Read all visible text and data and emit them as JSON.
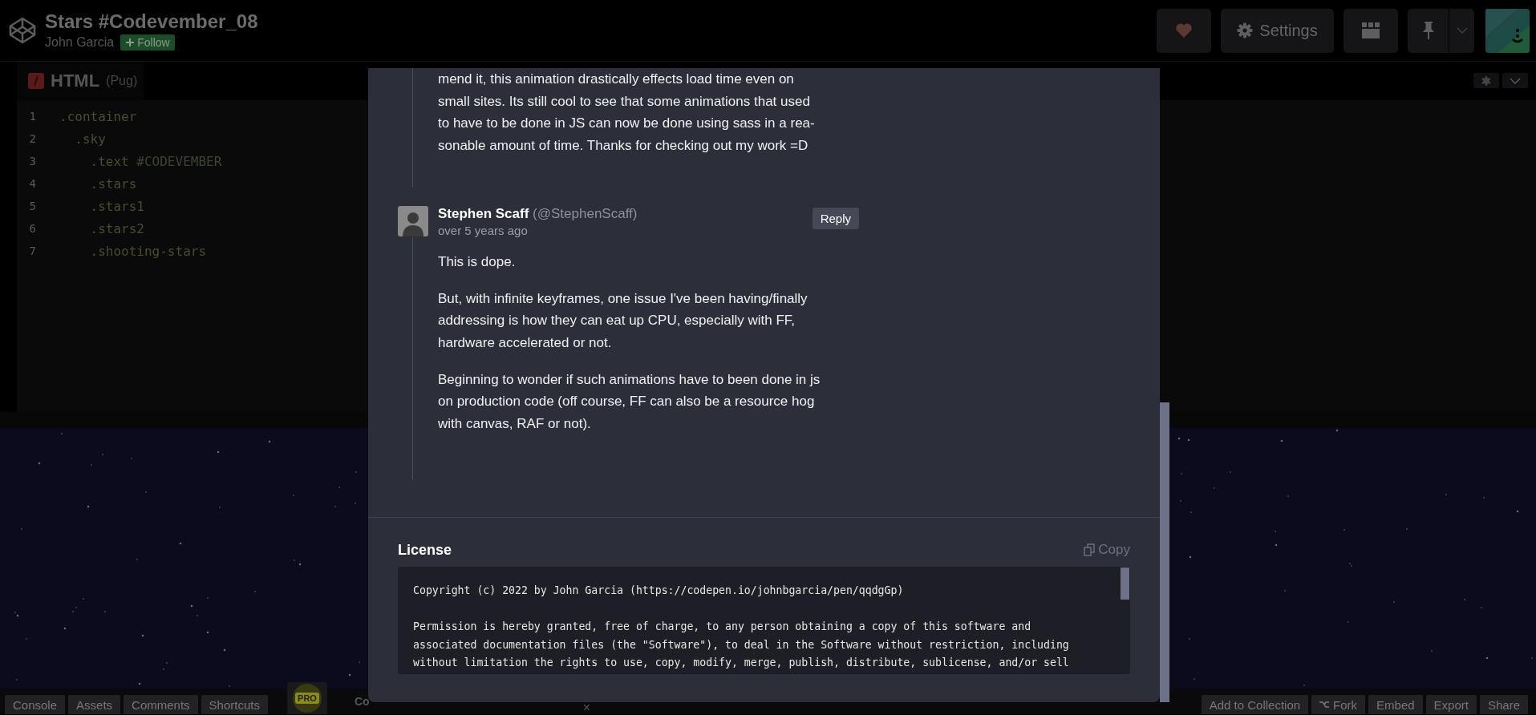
{
  "header": {
    "title": "Stars #Codevember_08",
    "author": "John Garcia",
    "follow": "Follow",
    "settings": "Settings"
  },
  "editor": {
    "tab": {
      "name": "HTML",
      "lang": "(Pug)"
    },
    "lines": [
      {
        "num": "1",
        "text": ".container"
      },
      {
        "num": "2",
        "text": "  .sky"
      },
      {
        "num": "3",
        "text": "    .text",
        "rest": " #CODEVEMBER"
      },
      {
        "num": "4",
        "text": "    .stars"
      },
      {
        "num": "5",
        "text": "    .stars1"
      },
      {
        "num": "6",
        "text": "    .stars2"
      },
      {
        "num": "7",
        "text": "    .shooting-stars"
      }
    ]
  },
  "footer": {
    "left": [
      "Console",
      "Assets",
      "Comments",
      "Shortcuts"
    ],
    "pro": "PRO",
    "partial": "Co",
    "close": "×",
    "right": [
      {
        "label": "Add to Collection",
        "kind": "plain"
      },
      {
        "label": "Fork",
        "kind": "fork"
      },
      {
        "label": "Embed",
        "kind": "plain"
      },
      {
        "label": "Export",
        "kind": "plain"
      },
      {
        "label": "Share",
        "kind": "plain"
      }
    ]
  },
  "modal": {
    "comments": [
      {
        "paragraphs": [
          [
            "mend it, this animation drastically effects load time even on",
            "small sites. Its still cool to see that some animations that used",
            "to have to be done in JS can now be done using sass in a rea-",
            "sonable amount of time. Thanks for checking out my work =D"
          ]
        ]
      },
      {
        "author": "Stephen Scaff",
        "handle": "(@StephenScaff)",
        "time": "over 5 years ago",
        "reply": "Reply",
        "paragraphs": [
          [
            "This is dope."
          ],
          [
            "But, with infinite keyframes, one issue I've been having/finally",
            "addressing is how they can eat up CPU, especially with FF,",
            "hardware accelerated or not."
          ],
          [
            "Beginning to wonder if such animations have to been done in js",
            "on production code (off course, FF can also be a resource hog",
            "with canvas, RAF or not)."
          ]
        ]
      }
    ],
    "license": {
      "title": "License",
      "copy": "Copy",
      "paragraphs": [
        [
          "Copyright (c) 2022 by John Garcia (https://codepen.io/johnbgarcia/pen/qqdgGp)"
        ],
        [
          "Permission is hereby granted, free of charge, to any person obtaining a copy of this software and",
          "associated documentation files (the \"Software\"), to deal in the Software without restriction, including",
          "without limitation the rights to use, copy, modify, merge, publish, distribute, sublicense, and/or sell"
        ]
      ]
    }
  }
}
